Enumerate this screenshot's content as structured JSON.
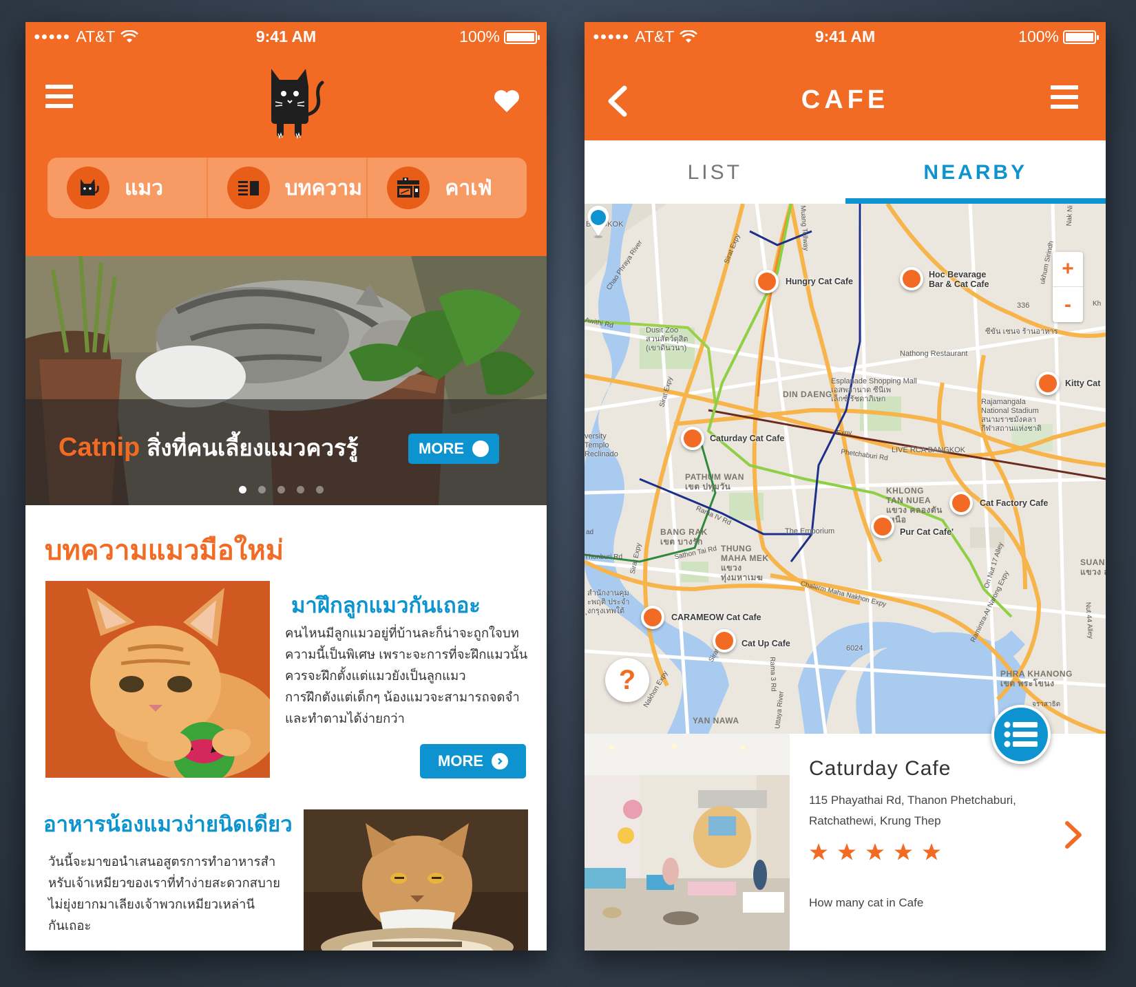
{
  "status_bar": {
    "signal": "●●●●●",
    "carrier": "AT&T",
    "time": "9:41 AM",
    "battery": "100%"
  },
  "colors": {
    "brand_orange": "#f26b24",
    "accent_blue": "#0d94d0"
  },
  "left": {
    "category_tabs": [
      {
        "label": "แมว",
        "icon": "cat-icon"
      },
      {
        "label": "บทความ",
        "icon": "article-icon"
      },
      {
        "label": "คาเฟ่",
        "icon": "cafe-icon"
      }
    ],
    "hero": {
      "accent": "Catnip",
      "caption": "สิ่งที่คนเลี้ยงแมวควรรู้",
      "more_label": "MORE",
      "slide_count": 5,
      "active_slide": 1
    },
    "section_title": "บทความแมวมือใหม่",
    "article1": {
      "title": "มาฝึกลูกแมวกันเถอะ",
      "lines": [
        "คนไหนมีลูกแมวอยู่ที่บ้านละก็น่าจะถูกใจบท",
        "ความนี้เป็นพิเศษ เพราะจะการที่จะฝึกแมวนั้น",
        "ควรจะฝึกตั้งแต่แมวยังเป็นลูกแมว",
        "การฝึกตังแต่เด็กๆ น้องแมวจะสามารถจดจำ",
        "และทำตามได้ง่ายกว่า"
      ],
      "more_label": "MORE"
    },
    "article2": {
      "title": "อาหารน้องแมวง่ายนิดเดียว",
      "lines": [
        "วันนี้จะมาขอนำเสนอสูตรการทำอาหารสำ",
        "หรับเจ้าเหมียวของเราที่ทำง่ายสะดวกสบาย",
        "ไม่ยุ่งยากมาเลียงเจ้าพวกเหมียวเหล่านี",
        "กันเถอะ"
      ]
    }
  },
  "right": {
    "title": "CAFE",
    "tabs": [
      {
        "label": "LIST"
      },
      {
        "label": "NEARBY"
      }
    ],
    "active_tab": "NEARBY",
    "map": {
      "zoom_in": "+",
      "zoom_out": "-",
      "help": "?",
      "cafes": [
        {
          "name": "Hungry Cat Cafe"
        },
        {
          "name": "Hoc Bevarage"
        },
        {
          "name": "Bar & Cat Cafe"
        },
        {
          "name": "Kitty Cat"
        },
        {
          "name": "Caturday Cat Cafe"
        },
        {
          "name": "Cat Factory Cafe"
        },
        {
          "name": "Pur Cat Cafe'"
        },
        {
          "name": "CARAMEOW Cat Cafe"
        },
        {
          "name": "Cat Up Cafe"
        }
      ],
      "places": [
        "Dusit Zoo",
        "สวนสัตว์ดุสิต",
        "(เขาดินวนา)",
        "Nathong Restaurant",
        "Esplanade Shopping Mall",
        "เอสพลานาด ซีนีเพ",
        "เล็กซ์ รัชดาภิเษก",
        "Rajamangala",
        "National Stadium",
        "สนามราชมังคลา",
        "กีฬาสถานแห่งชาติ",
        "LIVE RCA BANGKOK",
        "The Emporium",
        "versity",
        "Templo",
        "Reclinado",
        "ซีขัน เชนจ ร้านอาหาร",
        "สำนักงานคุม",
        "ะพฤติ ประจำ",
        "ุงกรุงเทพใต้",
        "BANGKOK",
        "6024",
        "336"
      ],
      "districts": [
        "DIN DAENG",
        "PATHUM WAN",
        "เขต ปทุมวัน",
        "KHLONG",
        "TAN NUEA",
        "แขวง คลองตัน",
        "เหนือ",
        "BANG RAK",
        "เขต บางรัก",
        "THUNG",
        "MAHA MEK",
        "แขวง",
        "ทุ่งมหาเมฆ",
        "SUAN L",
        "แขวง ส",
        "PHRA KHANONG",
        "เขต พระโขนง",
        "YAN NAWA"
      ],
      "roads": [
        "Sirat Expy",
        "Chao Phraya River",
        "Phetchaburi Rd",
        "Rama IV Rd",
        "Sathon Tai Rd",
        "Chalerm Maha Nakhon Expy",
        "Ramintra-At Narong Expy",
        "Sirat Expy",
        "Nakhon Expy",
        "Rama 3 Rd",
        "Thonburi Rd",
        "Uttaya River",
        "On Nut 17 Alley",
        "Sirat Expy",
        "Muang Tollway",
        "Sirat Expy",
        "Awithi Rd",
        "Nak Ni",
        "Nut 44 Alley",
        "Expy"
      ],
      "also_shown": [
        "Kh",
        "ad",
        "จราสาธิต",
        "ukhum Sirindh"
      ]
    },
    "card": {
      "name": "Caturday  Cafe",
      "address": "115  Phayathai  Rd,  Thanon  Phetchaburi,  Ratchathewi,  Krung  Thep",
      "rating": 5,
      "cat_count_label": "How  many  cat  in  Cafe"
    }
  }
}
